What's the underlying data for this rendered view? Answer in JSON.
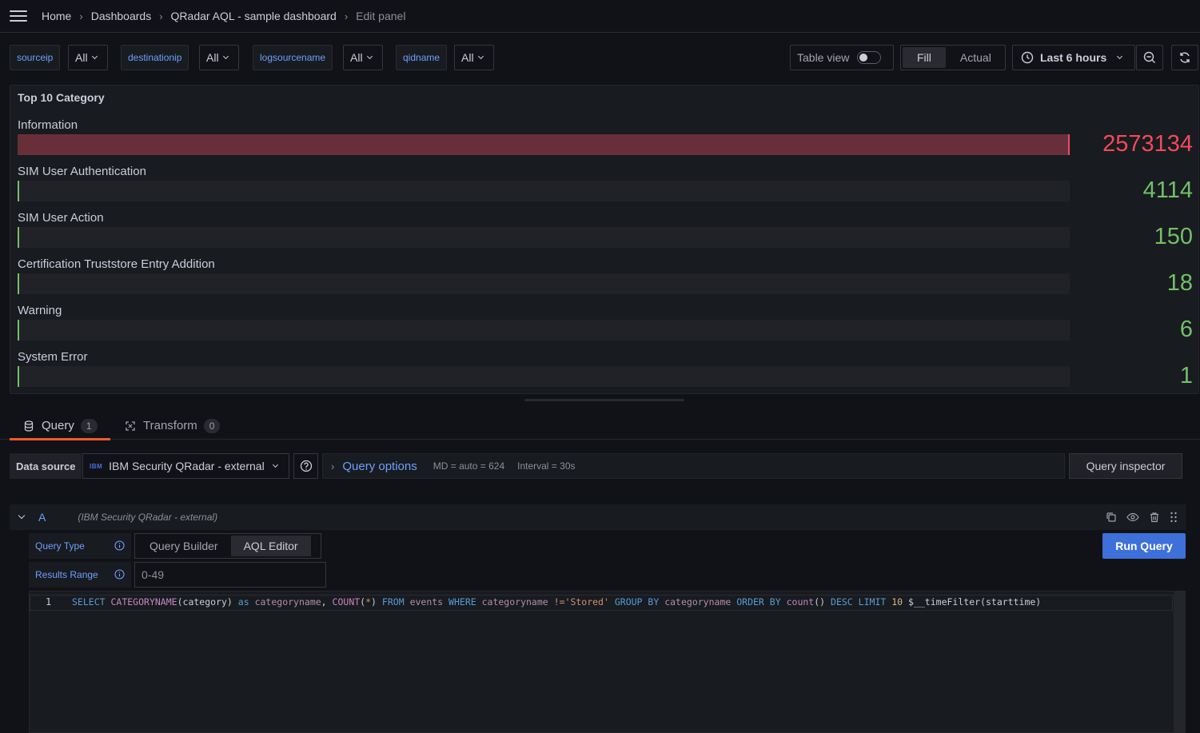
{
  "breadcrumb": {
    "items": [
      "Home",
      "Dashboards",
      "QRadar AQL - sample dashboard"
    ],
    "current": "Edit panel"
  },
  "variables": [
    {
      "name": "sourceip",
      "value": "All"
    },
    {
      "name": "destinationip",
      "value": "All"
    },
    {
      "name": "logsourcename",
      "value": "All"
    },
    {
      "name": "qidname",
      "value": "All"
    }
  ],
  "toolbar": {
    "table_view_label": "Table view",
    "fill_label": "Fill",
    "actual_label": "Actual",
    "time_range": "Last 6 hours"
  },
  "panel": {
    "title": "Top 10 Category",
    "max_value": 2573134,
    "rows": [
      {
        "label": "Information",
        "value": 2573134,
        "display": "2573134",
        "color": "#f2495c"
      },
      {
        "label": "SIM User Authentication",
        "value": 4114,
        "display": "4114",
        "color": "#73bf69"
      },
      {
        "label": "SIM User Action",
        "value": 150,
        "display": "150",
        "color": "#73bf69"
      },
      {
        "label": "Certification Truststore Entry Addition",
        "value": 18,
        "display": "18",
        "color": "#73bf69"
      },
      {
        "label": "Warning",
        "value": 6,
        "display": "6",
        "color": "#73bf69"
      },
      {
        "label": "System Error",
        "value": 1,
        "display": "1",
        "color": "#73bf69"
      }
    ]
  },
  "editor_tabs": [
    {
      "label": "Query",
      "count": "1"
    },
    {
      "label": "Transform",
      "count": "0"
    }
  ],
  "datasource": {
    "label": "Data source",
    "logo": "IBM",
    "selected": "IBM Security QRadar - external",
    "query_options_label": "Query options",
    "md_info": "MD = auto = 624",
    "interval_info": "Interval = 30s",
    "inspector_label": "Query inspector"
  },
  "query": {
    "ref_id": "A",
    "datasource_note": "(IBM Security QRadar - external)",
    "query_type_label": "Query Type",
    "query_type_options": [
      "Query Builder",
      "AQL Editor"
    ],
    "query_type_selected": "AQL Editor",
    "results_range_label": "Results Range",
    "results_range_value": "0-49",
    "run_label": "Run Query",
    "line_number": "1",
    "sql": "SELECT CATEGORYNAME(category) as categoryname, COUNT(*) FROM events WHERE categoryname !='Stored' GROUP BY categoryname ORDER BY count() DESC LIMIT 10 $__timeFilter(starttime)"
  },
  "colors": {
    "accent": "#6e9fff",
    "primary_button": "#3d71d9",
    "active_tab": "#f05a28",
    "danger": "#f2495c",
    "ok": "#73bf69"
  }
}
